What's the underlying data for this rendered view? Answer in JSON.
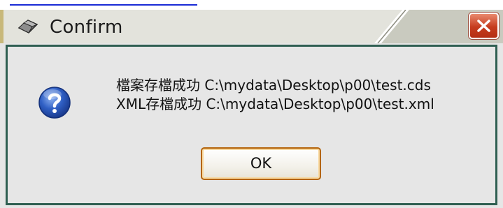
{
  "dialog": {
    "title": "Confirm",
    "close_label": "×",
    "title_icon": "gem-icon",
    "message_icon": "question-icon",
    "message_lines": [
      "檔案存檔成功 C:\\mydata\\Desktop\\p00\\test.cds",
      "XML存檔成功 C:\\mydata\\Desktop\\p00\\test.xml"
    ],
    "ok_label": "OK"
  },
  "colors": {
    "content_border": "#2f5f52",
    "ok_border": "#b4650d",
    "close_button": "#c63c1e",
    "question_icon": "#2450b8"
  }
}
